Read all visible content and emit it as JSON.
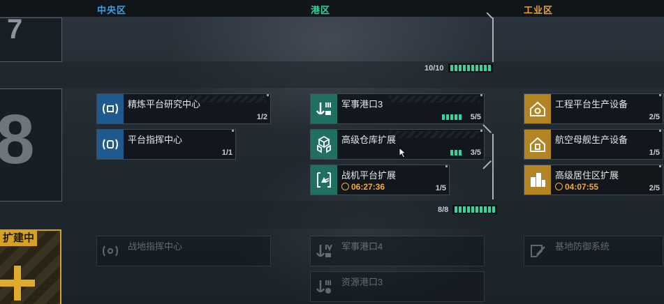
{
  "columns": {
    "central": {
      "title": "中央区",
      "color": "#3aa0e8"
    },
    "port": {
      "title": "港区",
      "color": "#36d39a"
    },
    "industrial": {
      "title": "工业区",
      "color": "#e8a23a"
    }
  },
  "tiers": {
    "top_glyph": "7",
    "mid_glyph": "8",
    "bottom_label": "扩建中"
  },
  "progress": [
    {
      "text": "10/10",
      "segments": 10,
      "filled": 10
    },
    {
      "text": "8/8",
      "segments": 10,
      "filled": 10
    }
  ],
  "cards": {
    "refine_research": {
      "name": "精炼平台研究中心",
      "count": "1/2",
      "icon": "radio-signal-icon"
    },
    "platform_command": {
      "name": "平台指挥中心",
      "count": "1/1",
      "icon": "command-signal-icon"
    },
    "military_port3": {
      "name": "军事港口3",
      "count": "5/5",
      "icon": "anchor-icon",
      "mini": 5
    },
    "warehouse": {
      "name": "高级仓库扩展",
      "count": "3/5",
      "icon": "crates-icon",
      "mini": 3
    },
    "fighter_platform": {
      "name": "战机平台扩展",
      "count": "1/5",
      "timer": "06:27:36",
      "icon": "fighter-icon"
    },
    "eng_platform": {
      "name": "工程平台生产设备",
      "count": "2/5",
      "icon": "house-gear-icon"
    },
    "carrier_prod": {
      "name": "航空母舰生产设备",
      "count": "1/5",
      "icon": "house-gear-icon"
    },
    "residential": {
      "name": "高级居住区扩展",
      "count": "2/5",
      "timer": "04:07:55",
      "icon": "buildings-icon"
    },
    "field_command": {
      "name": "战地指挥中心",
      "icon": "radio-signal-icon"
    },
    "military_port4": {
      "name": "军事港口4",
      "icon": "anchor-icon"
    },
    "resource_port3": {
      "name": "资源港口3",
      "icon": "anchor-icon"
    },
    "base_defense": {
      "name": "基地防御系统",
      "icon": "shield-icon"
    }
  }
}
